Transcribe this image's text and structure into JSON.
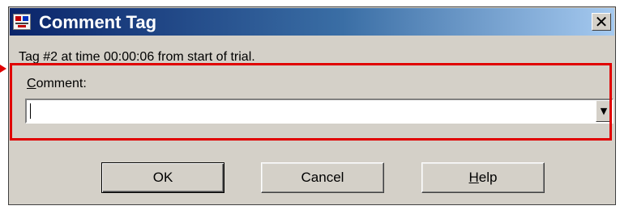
{
  "window": {
    "title": "Comment Tag",
    "close_symbol": "✕"
  },
  "info": {
    "text": "Tag #2 at time 00:00:06 from start of trial."
  },
  "comment": {
    "label_first": "C",
    "label_rest": "omment:",
    "value": "",
    "dropdown_symbol": "▼"
  },
  "buttons": {
    "ok": "OK",
    "cancel": "Cancel",
    "help_first": "H",
    "help_rest": "elp"
  },
  "colors": {
    "highlight": "#e00000",
    "titlebar_start": "#0a246a",
    "dialog_bg": "#d4d0c8"
  },
  "icons": {
    "title": "app-icon",
    "close": "close-icon",
    "dropdown": "chevron-down-icon"
  }
}
